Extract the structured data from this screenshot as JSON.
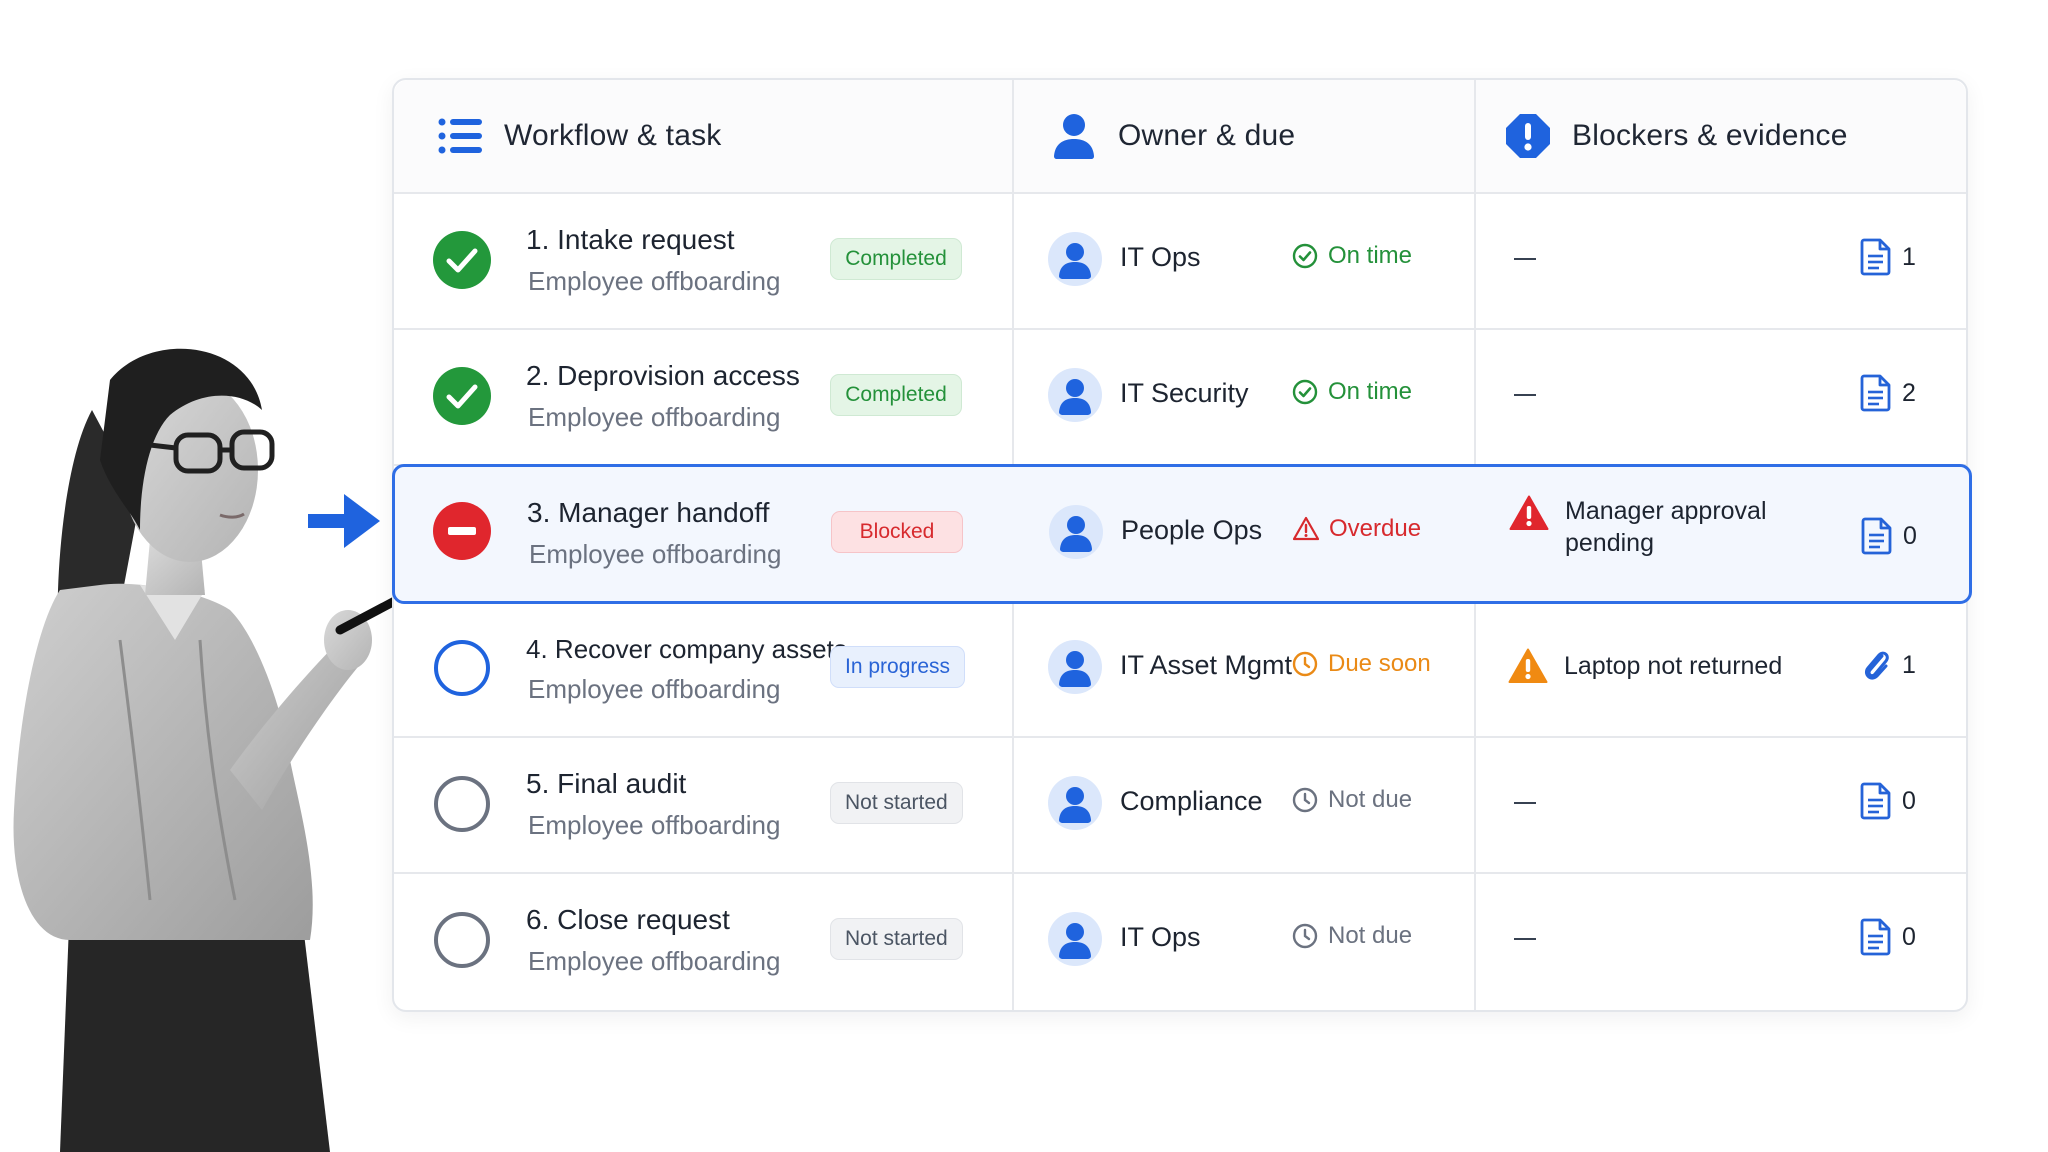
{
  "columns": {
    "task": "Workflow & task",
    "owner": "Owner & due",
    "blockers": "Blockers & evidence"
  },
  "rows": [
    {
      "number": "1.",
      "title": "Intake request",
      "subtitle": "Employee offboarding",
      "status": "Completed",
      "owner": "IT Ops",
      "due": "On time",
      "blocker": "—",
      "evidence": "1"
    },
    {
      "number": "2.",
      "title": "Deprovision access",
      "subtitle": "Employee offboarding",
      "status": "Completed",
      "owner": "IT Security",
      "due": "On time",
      "blocker": "—",
      "evidence": "2"
    },
    {
      "number": "3.",
      "title": "Manager handoff",
      "subtitle": "Employee offboarding",
      "status": "Blocked",
      "owner": "People Ops",
      "due": "Overdue",
      "blocker": "Manager approval pending",
      "evidence": "0"
    },
    {
      "number": "4.",
      "title": "Recover company assets",
      "subtitle": "Employee offboarding",
      "status": "In progress",
      "owner": "IT Asset Mgmt",
      "due": "Due soon",
      "blocker": "Laptop not returned",
      "evidence": "1"
    },
    {
      "number": "5.",
      "title": "Final audit",
      "subtitle": "Employee offboarding",
      "status": "Not started",
      "owner": "Compliance",
      "due": "Not due",
      "blocker": "—",
      "evidence": "0"
    },
    {
      "number": "6.",
      "title": "Close request",
      "subtitle": "Employee offboarding",
      "status": "Not started",
      "owner": "IT Ops",
      "due": "Not due",
      "blocker": "—",
      "evidence": "0"
    }
  ],
  "colors": {
    "accent": "#2f6ee6",
    "success": "#24913a",
    "danger": "#d72a2e",
    "warning": "#ea8a16",
    "muted": "#6b7280"
  },
  "icons": {
    "header_task": "list-icon",
    "header_owner": "person-icon",
    "header_blockers": "alert-octagon-icon",
    "evidence_doc": "document-icon",
    "evidence_attachment": "paperclip-icon"
  }
}
